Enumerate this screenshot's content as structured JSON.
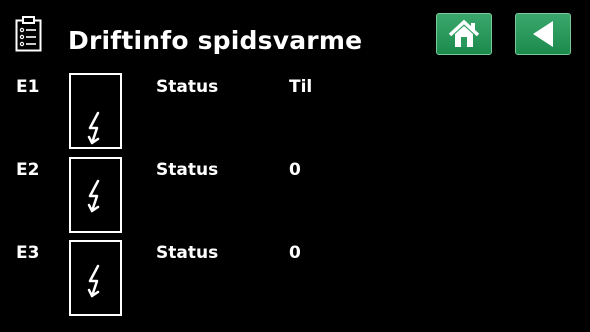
{
  "header": {
    "title": "Driftinfo spidsvarme",
    "header_icon": "clipboard-list-icon",
    "home_button_icon": "home-icon",
    "back_button_icon": "back-arrow-icon",
    "button_color": "#2a9a5c"
  },
  "rows": [
    {
      "id": "E1",
      "status_label": "Status",
      "status_value": "Til",
      "icon": "electric-heater-icon"
    },
    {
      "id": "E2",
      "status_label": "Status",
      "status_value": "0",
      "icon": "electric-heater-icon"
    },
    {
      "id": "E3",
      "status_label": "Status",
      "status_value": "0",
      "icon": "electric-heater-icon"
    }
  ]
}
